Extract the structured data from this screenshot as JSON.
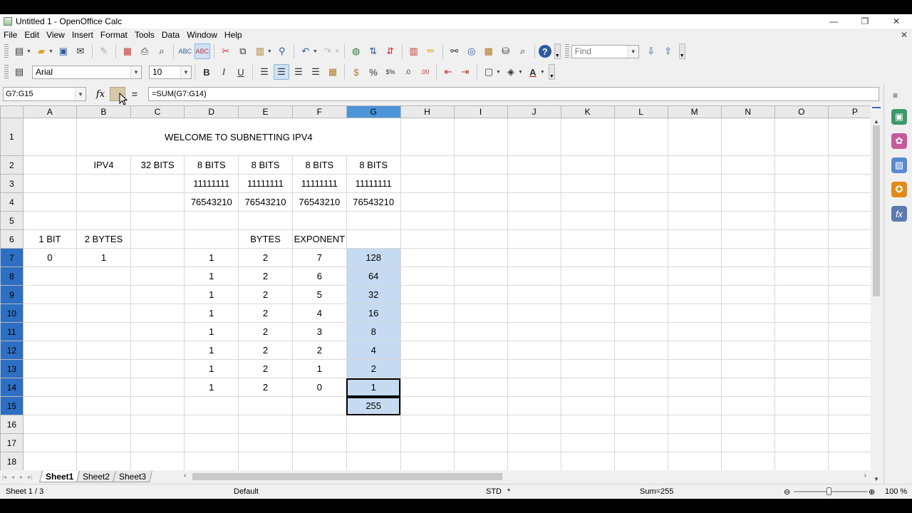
{
  "window": {
    "title": "Untitled 1 - OpenOffice Calc",
    "minimize": "—",
    "maximize": "❐",
    "close": "✕",
    "doc_close": "✕"
  },
  "menu": [
    "File",
    "Edit",
    "View",
    "Insert",
    "Format",
    "Tools",
    "Data",
    "Window",
    "Help"
  ],
  "toolbar": {
    "find_placeholder": "Find"
  },
  "format_toolbar": {
    "font_name": "Arial",
    "font_size": "10",
    "bold": "B",
    "italic": "I",
    "underline": "U"
  },
  "formula_bar": {
    "name_box": "G7:G15",
    "fx": "fx",
    "equals": "=",
    "formula": "=SUM(G7:G14)"
  },
  "columns": [
    "A",
    "B",
    "C",
    "D",
    "E",
    "F",
    "G",
    "H",
    "I",
    "J",
    "K",
    "L",
    "M",
    "N",
    "O",
    "P"
  ],
  "rows": [
    {
      "num": "1",
      "cells": {
        "title": "WELCOME TO SUBNETTING IPV4"
      }
    },
    {
      "num": "2",
      "cells": {
        "B": "IPV4",
        "C": "32 BITS",
        "D": "8 BITS",
        "E": "8 BITS",
        "F": "8 BITS",
        "G": "8 BITS"
      }
    },
    {
      "num": "3",
      "cells": {
        "D": "11111111",
        "E": "11111111",
        "F": "11111111",
        "G": "11111111"
      }
    },
    {
      "num": "4",
      "cells": {
        "D": "76543210",
        "E": "76543210",
        "F": "76543210",
        "G": "76543210"
      }
    },
    {
      "num": "5",
      "cells": {}
    },
    {
      "num": "6",
      "cells": {
        "A": "1 BIT",
        "B": "2 BYTES",
        "E": "BYTES",
        "F": "EXPONENT"
      }
    },
    {
      "num": "7",
      "cells": {
        "A": "0",
        "B": "1",
        "D": "1",
        "E": "2",
        "F": "7",
        "G": "128"
      }
    },
    {
      "num": "8",
      "cells": {
        "D": "1",
        "E": "2",
        "F": "6",
        "G": "64"
      }
    },
    {
      "num": "9",
      "cells": {
        "D": "1",
        "E": "2",
        "F": "5",
        "G": "32"
      }
    },
    {
      "num": "10",
      "cells": {
        "D": "1",
        "E": "2",
        "F": "4",
        "G": "16"
      }
    },
    {
      "num": "11",
      "cells": {
        "D": "1",
        "E": "2",
        "F": "3",
        "G": "8"
      }
    },
    {
      "num": "12",
      "cells": {
        "D": "1",
        "E": "2",
        "F": "2",
        "G": "4"
      }
    },
    {
      "num": "13",
      "cells": {
        "D": "1",
        "E": "2",
        "F": "1",
        "G": "2"
      }
    },
    {
      "num": "14",
      "cells": {
        "D": "1",
        "E": "2",
        "F": "0",
        "G": "1"
      }
    },
    {
      "num": "15",
      "cells": {
        "G": "255"
      }
    },
    {
      "num": "16",
      "cells": {}
    },
    {
      "num": "17",
      "cells": {}
    },
    {
      "num": "18",
      "cells": {}
    }
  ],
  "selection": {
    "column": "G",
    "rows": [
      "7",
      "8",
      "9",
      "10",
      "11",
      "12",
      "13",
      "14",
      "15"
    ],
    "boxed": [
      "14",
      "15"
    ]
  },
  "sheets": [
    "Sheet1",
    "Sheet2",
    "Sheet3"
  ],
  "active_sheet": "Sheet1",
  "status": {
    "sheet": "Sheet 1 / 3",
    "style": "Default",
    "mode": "STD",
    "modified": "*",
    "sum": "Sum=255",
    "zoom": "100 %"
  },
  "colors": {
    "selection_fill": "#c6dbf1",
    "header_selected": "#4c95d8",
    "row_selected": "#2d6fc2"
  }
}
